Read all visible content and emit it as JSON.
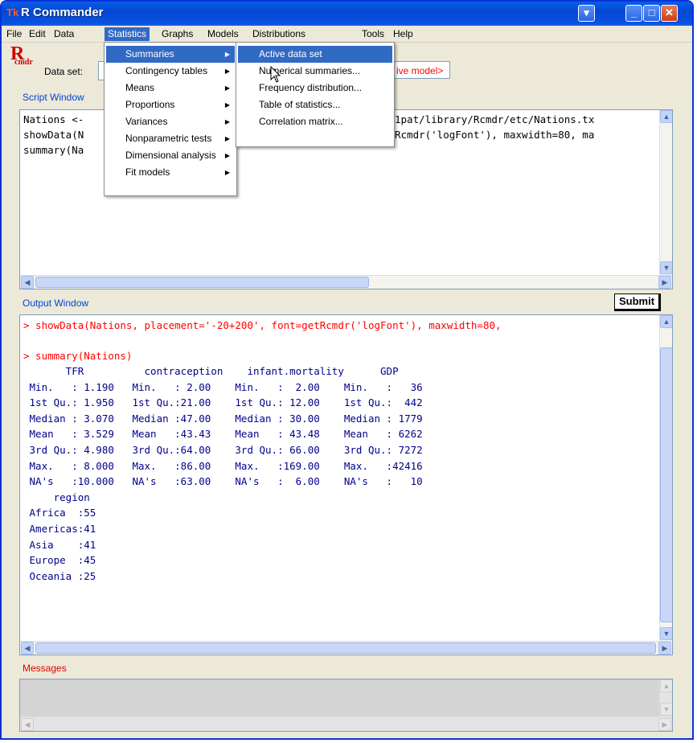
{
  "window": {
    "title": "R Commander",
    "title_icon": "Tk",
    "controls": {
      "dropdown": "▾",
      "minimize": "_",
      "maximize": "□",
      "close": "✕"
    }
  },
  "menubar": [
    "File",
    "Edit",
    "Data",
    "Statistics",
    "Graphs",
    "Models",
    "Distributions",
    "Tools",
    "Help"
  ],
  "toolbar": {
    "logo": "R",
    "logo_sub": "cmdr",
    "dataset_label": "Data set:",
    "model_text": "ive model>"
  },
  "script_window": {
    "label": "Script Window",
    "lines": [
      "Nations <-",
      "showData(N",
      "summary(Na"
    ],
    "right_lines": [
      "1pat/library/Rcmdr/etc/Nations.tx",
      "Rcmdr('logFont'), maxwidth=80, ma"
    ]
  },
  "submit_label": "Submit",
  "output_window": {
    "label": "Output Window",
    "commands": [
      "> showData(Nations, placement='-20+200', font=getRcmdr('logFont'), maxwidth=80,",
      "> summary(Nations)"
    ],
    "output_lines": [
      "       TFR          contraception    infant.mortality      GDP",
      " Min.   : 1.190   Min.   : 2.00    Min.   :  2.00    Min.   :   36",
      " 1st Qu.: 1.950   1st Qu.:21.00    1st Qu.: 12.00    1st Qu.:  442",
      " Median : 3.070   Median :47.00    Median : 30.00    Median : 1779",
      " Mean   : 3.529   Mean   :43.43    Mean   : 43.48    Mean   : 6262",
      " 3rd Qu.: 4.980   3rd Qu.:64.00    3rd Qu.: 66.00    3rd Qu.: 7272",
      " Max.   : 8.000   Max.   :86.00    Max.   :169.00    Max.   :42416",
      " NA's   :10.000   NA's   :63.00    NA's   :  6.00    NA's   :   10",
      "     region",
      " Africa  :55",
      " Americas:41",
      " Asia    :41",
      " Europe  :45",
      " Oceania :25"
    ]
  },
  "messages_label": "Messages",
  "statistics_menu": {
    "items": [
      {
        "label": "Summaries",
        "submenu": true
      },
      {
        "label": "Contingency tables",
        "submenu": true
      },
      {
        "label": "Means",
        "submenu": true
      },
      {
        "label": "Proportions",
        "submenu": true
      },
      {
        "label": "Variances",
        "submenu": true
      },
      {
        "label": "Nonparametric tests",
        "submenu": true
      },
      {
        "label": "Dimensional analysis",
        "submenu": true
      },
      {
        "label": "Fit models",
        "submenu": true
      }
    ],
    "highlighted": "Summaries"
  },
  "summaries_menu": {
    "items": [
      "Active data set",
      "Numerical summaries...",
      "Frequency distribution...",
      "Table of statistics...",
      "Correlation matrix..."
    ],
    "highlighted": "Active data set"
  },
  "colors": {
    "command_red": "#ff0000",
    "output_blue": "#00008b",
    "highlight": "#316ac5",
    "label_blue": "#0046d5"
  }
}
